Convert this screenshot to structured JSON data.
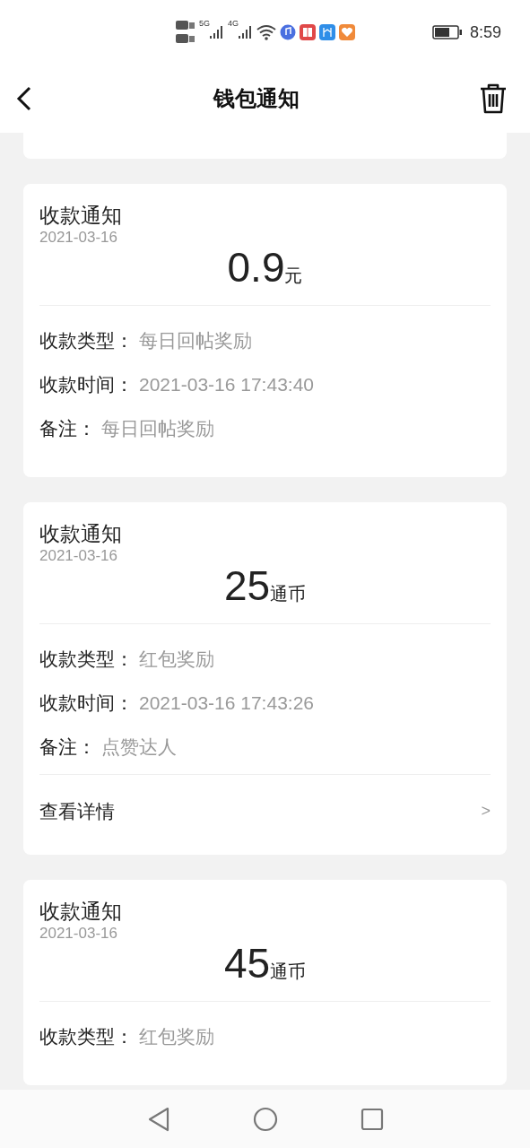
{
  "status_bar": {
    "signals": [
      "5G",
      "4G"
    ],
    "time": "8:59"
  },
  "header": {
    "title": "钱包通知"
  },
  "notifications": [
    {
      "title": "收款通知",
      "date": "2021-03-16",
      "amount": "0.9",
      "unit": "元",
      "fields": [
        {
          "label": "收款类型：",
          "value": "每日回帖奖励"
        },
        {
          "label": "收款时间：",
          "value": "2021-03-16 17:43:40"
        },
        {
          "label": "备注：",
          "value": "每日回帖奖励"
        }
      ]
    },
    {
      "title": "收款通知",
      "date": "2021-03-16",
      "amount": "25",
      "unit": "通币",
      "fields": [
        {
          "label": "收款类型：",
          "value": "红包奖励"
        },
        {
          "label": "收款时间：",
          "value": "2021-03-16 17:43:26"
        },
        {
          "label": "备注：",
          "value": "点赞达人"
        }
      ],
      "link": {
        "label": "查看详情",
        "chevron": ">"
      }
    },
    {
      "title": "收款通知",
      "date": "2021-03-16",
      "amount": "45",
      "unit": "通币",
      "fields": [
        {
          "label": "收款类型：",
          "value": "红包奖励"
        }
      ]
    }
  ]
}
